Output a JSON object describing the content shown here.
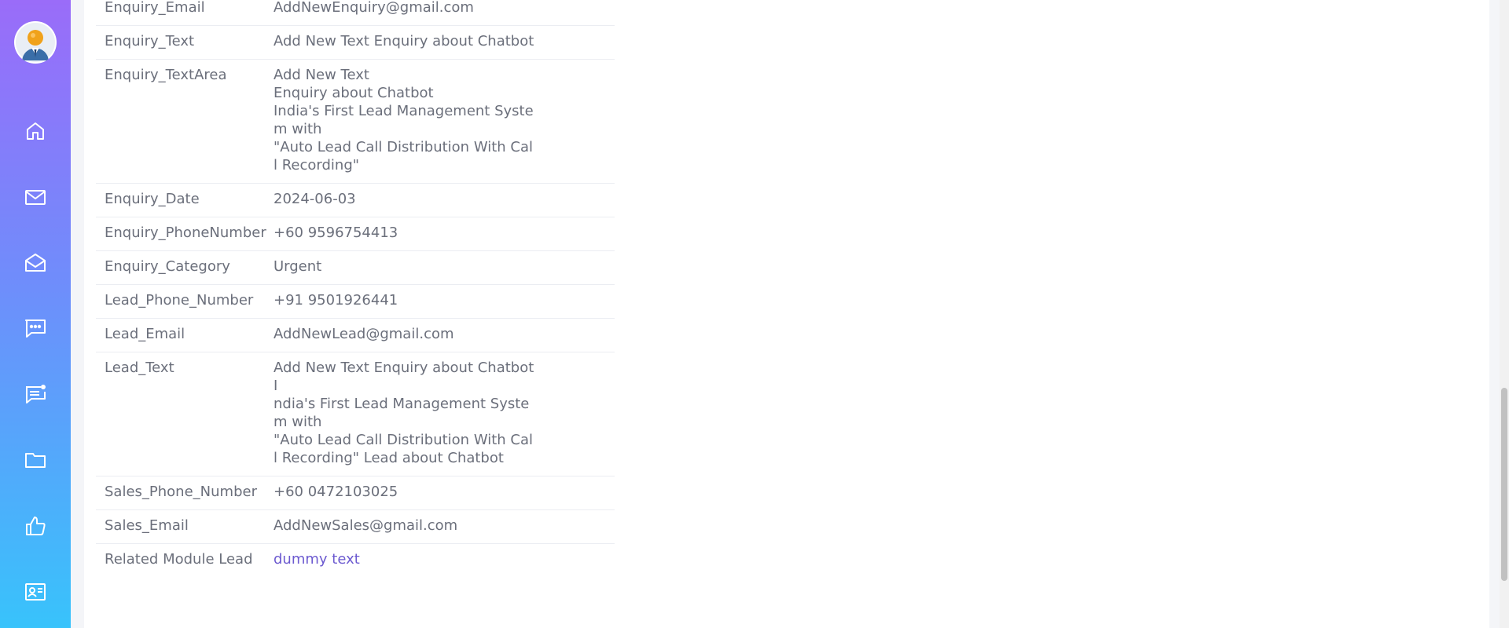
{
  "sidebar": {
    "items": [
      {
        "icon": "home-icon"
      },
      {
        "icon": "mail-icon"
      },
      {
        "icon": "mail-open-icon"
      },
      {
        "icon": "chat-icon"
      },
      {
        "icon": "message-notification-icon"
      },
      {
        "icon": "folder-icon"
      },
      {
        "icon": "thumbs-up-icon"
      },
      {
        "icon": "contact-card-icon"
      }
    ]
  },
  "details": {
    "rows": [
      {
        "label": "Enquiry_Email",
        "value": "AddNewEnquiry@gmail.com"
      },
      {
        "label": "Enquiry_Text",
        "value": "Add New Text Enquiry about Chatbot"
      },
      {
        "label": "Enquiry_TextArea",
        "value": "Add New Text\nEnquiry about Chatbot\nIndia's First Lead Management Syste\nm with\n\"Auto Lead Call Distribution With Cal\nl Recording\""
      },
      {
        "label": "Enquiry_Date",
        "value": "2024-06-03"
      },
      {
        "label": "Enquiry_PhoneNumber",
        "value": "+60   9596754413"
      },
      {
        "label": "Enquiry_Category",
        "value": "Urgent"
      },
      {
        "label": "Lead_Phone_Number",
        "value": "+91   9501926441"
      },
      {
        "label": "Lead_Email",
        "value": "AddNewLead@gmail.com"
      },
      {
        "label": "Lead_Text",
        "value": "Add New Text Enquiry about Chatbot I\nndia's First Lead Management Syste\nm with\n\"Auto Lead Call Distribution With Cal\nl Recording\" Lead about Chatbot"
      },
      {
        "label": "Sales_Phone_Number",
        "value": "+60   0472103025"
      },
      {
        "label": "Sales_Email",
        "value": "AddNewSales@gmail.com"
      },
      {
        "label": "Related Module Lead",
        "value": "dummy text"
      }
    ]
  },
  "colors": {
    "sidebar_top": "#9a6cf9",
    "sidebar_bottom": "#38c3fb",
    "link": "#6c5ad0",
    "text": "#6b6f7b"
  }
}
